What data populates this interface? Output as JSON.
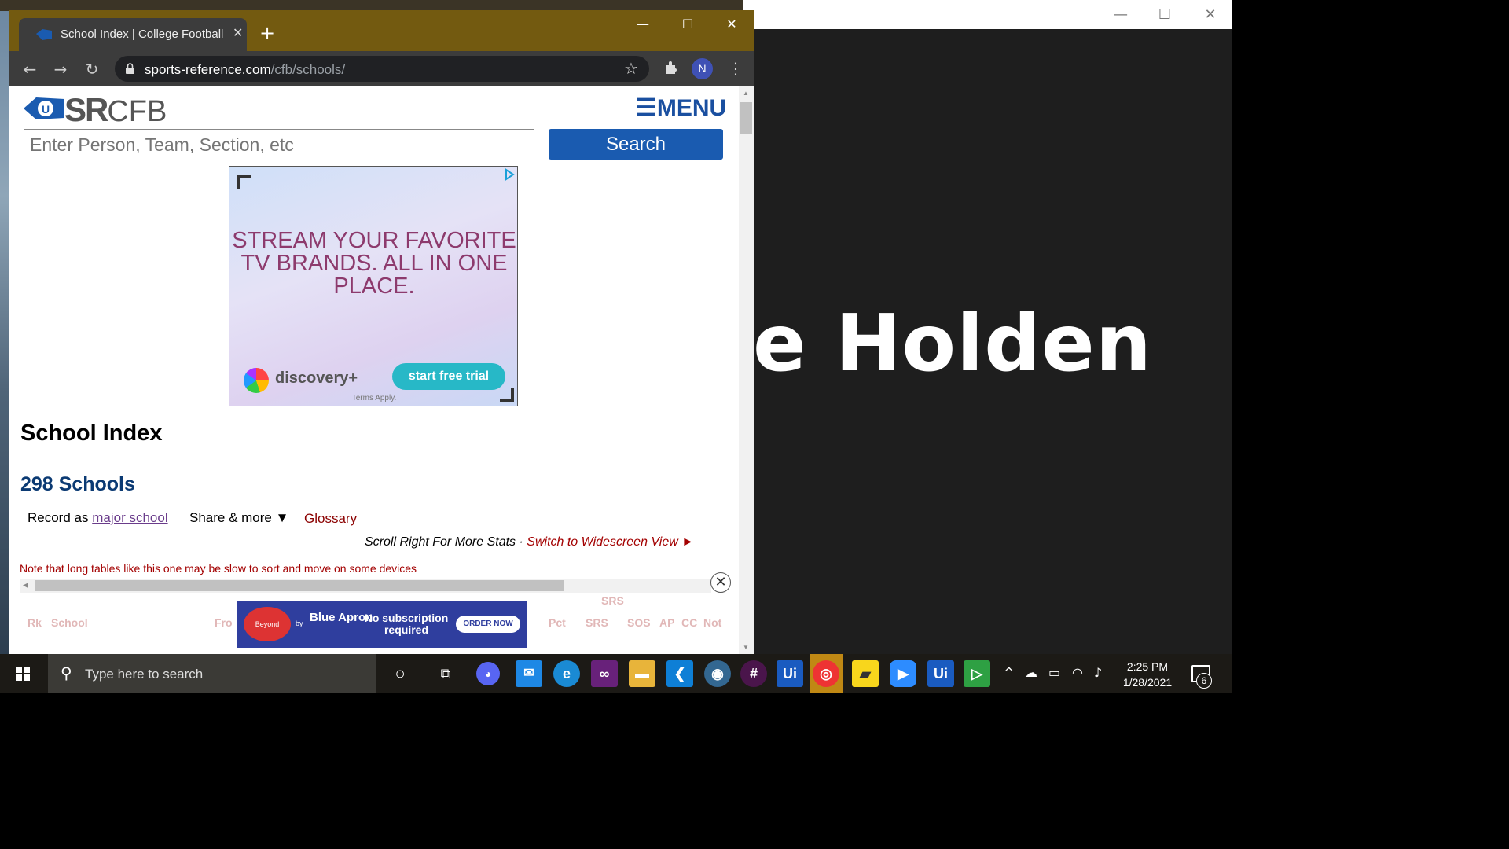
{
  "browser": {
    "tab_title": "School Index | College Football a",
    "tab_close": "✕",
    "new_tab": "+",
    "url_domain": "sports-reference.com",
    "url_path": "/cfb/schools/",
    "profile_initial": "N",
    "minimize": "—",
    "maximize": "☐",
    "close": "✕"
  },
  "right_window": {
    "big_text": "e Holden",
    "minimize": "—",
    "maximize": "☐",
    "close": "✕"
  },
  "site": {
    "logo_sr": "SR",
    "logo_cfb": "CFB",
    "menu_label": "☰MENU",
    "search_placeholder": "Enter Person, Team, Section, etc",
    "search_button": "Search"
  },
  "ad_top": {
    "headline": "STREAM YOUR FAVORITE TV BRANDS. ALL IN ONE PLACE.",
    "brand": "discovery+",
    "cta": "start free trial",
    "terms": "Terms Apply."
  },
  "page": {
    "title": "School Index",
    "count": "298 Schools",
    "record_as": "Record as",
    "record_link": "major school",
    "share": "Share & more ▼",
    "glossary": "Glossary",
    "scroll_note": "Scroll Right For More Stats · ",
    "widescreen_link": "Switch to Widescreen View  ►",
    "slow_note": "Note that long tables like this one may be slow to sort and move on some devices"
  },
  "table": {
    "group_header": "SRS",
    "headers": [
      "Rk",
      "School",
      "Fro",
      "Pct",
      "SRS",
      "SOS",
      "AP",
      "CC",
      "Not"
    ]
  },
  "ad_bottom": {
    "logo": "Beyond",
    "by": "by",
    "brand": "Blue Apron",
    "tagline": "No subscription required",
    "cta": "ORDER NOW"
  },
  "taskbar": {
    "search_placeholder": "Type here to search",
    "time": "2:25 PM",
    "date": "1/28/2021",
    "notification_count": "6"
  },
  "colors": {
    "tab_strip": "#735a10",
    "brand_blue": "#1a5bb0",
    "count_blue": "#0b3a73",
    "link_red": "#a30000",
    "taskbar_active": "#c08814"
  }
}
